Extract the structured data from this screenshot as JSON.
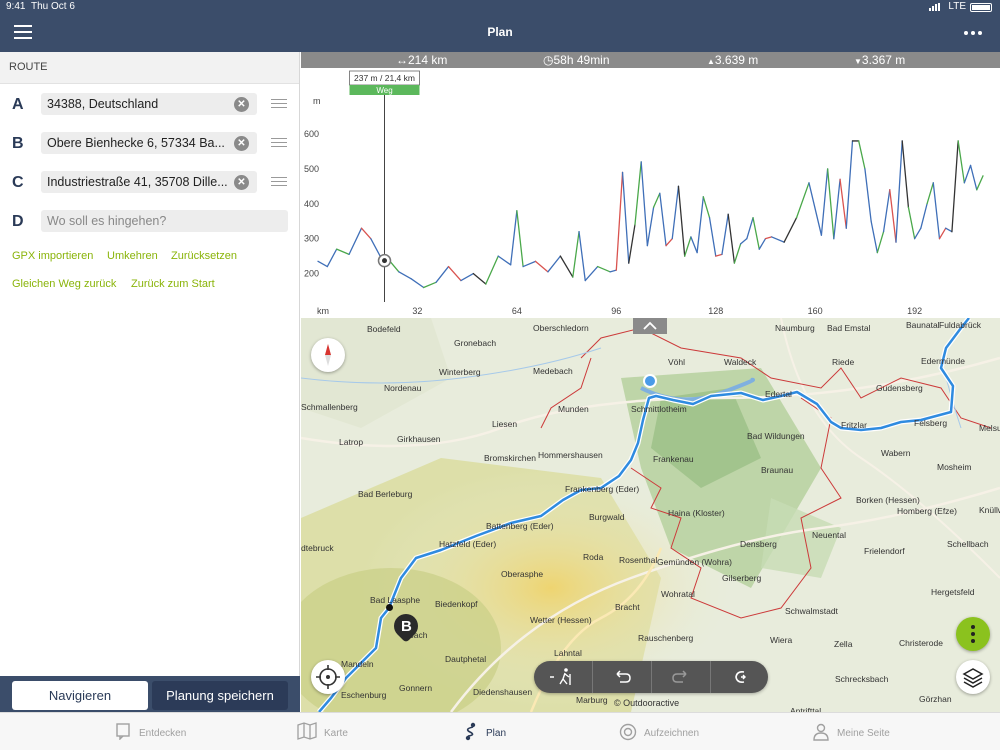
{
  "status_bar": {
    "time": "9:41",
    "date": "Thu Oct 6",
    "network": "LTE"
  },
  "nav": {
    "title": "Plan"
  },
  "route": {
    "header": "ROUTE",
    "waypoints": [
      {
        "letter": "A",
        "value": "34388, Deutschland"
      },
      {
        "letter": "B",
        "value": "Obere Bienhecke 6, 57334 Ba..."
      },
      {
        "letter": "C",
        "value": "Industriestraße 41, 35708 Dille..."
      },
      {
        "letter": "D",
        "value": "",
        "placeholder": "Wo soll es hingehen?"
      }
    ],
    "actions_row1": [
      "GPX importieren",
      "Umkehren",
      "Zurücksetzen"
    ],
    "actions_row2": [
      "Gleichen Weg zurück",
      "Zurück zum Start"
    ],
    "navigate_label": "Navigieren",
    "save_label": "Planung speichern"
  },
  "stats": {
    "distance": "214 km",
    "duration": "58h 49min",
    "ascent": "3.639 m",
    "descent": "3.367 m"
  },
  "profile": {
    "y_unit": "m",
    "x_unit": "km",
    "cursor_label": "237 m / 21,4 km",
    "cursor_surface": "Weg",
    "surface_colors": {
      "trail": "#3f6fb8",
      "road": "#4aa84a",
      "path": "#d9534f",
      "unknown": "#333333"
    }
  },
  "chart_data": {
    "type": "line",
    "title": "",
    "xlabel": "km",
    "ylabel": "m",
    "xlim": [
      0,
      214
    ],
    "ylim": [
      130,
      640
    ],
    "x_ticks": [
      32,
      64,
      96,
      128,
      160,
      192
    ],
    "y_ticks": [
      200,
      300,
      400,
      500,
      600
    ],
    "cursor": {
      "x": 21.4,
      "y": 237
    },
    "series": [
      {
        "x": [
          0,
          3,
          6,
          10,
          14,
          17,
          20,
          23,
          26,
          30,
          34,
          38,
          42,
          46,
          50,
          54,
          58,
          62,
          64,
          66,
          70,
          74,
          78,
          82,
          84,
          86,
          90,
          94,
          96,
          98,
          100,
          102,
          104,
          106,
          108,
          110,
          112,
          114,
          116,
          118,
          120,
          122,
          124,
          126,
          128,
          130,
          132,
          134,
          136,
          138,
          140,
          142,
          144,
          146,
          150,
          154,
          158,
          162,
          164,
          166,
          168,
          170,
          172,
          174,
          176,
          178,
          180,
          182,
          184,
          186,
          188,
          190,
          192,
          194,
          196,
          198,
          200,
          202,
          204,
          206,
          208,
          210,
          212,
          214
        ],
        "y": [
          235,
          220,
          270,
          255,
          330,
          300,
          250,
          237,
          205,
          185,
          160,
          175,
          220,
          180,
          200,
          170,
          250,
          225,
          380,
          220,
          235,
          205,
          250,
          190,
          320,
          180,
          220,
          205,
          210,
          490,
          230,
          340,
          520,
          280,
          390,
          430,
          280,
          300,
          450,
          250,
          305,
          260,
          420,
          360,
          250,
          255,
          370,
          230,
          285,
          300,
          360,
          270,
          300,
          305,
          290,
          360,
          460,
          310,
          500,
          300,
          470,
          330,
          580,
          580,
          500,
          350,
          260,
          320,
          440,
          290,
          580,
          390,
          300,
          330,
          400,
          460,
          300,
          330,
          320,
          580,
          460,
          510,
          440,
          480
        ]
      }
    ]
  },
  "map": {
    "places": [
      "Bodefeld",
      "Gronebach",
      "Oberschledorn",
      "Naumburg",
      "Bad Emstal",
      "Baunatal",
      "Fuldabrück",
      "Vöhl",
      "Waldeck",
      "Riede",
      "Edermünde",
      "Nordenau",
      "Winterberg",
      "Medebach",
      "Schmallenberg",
      "Schmittlotheim",
      "Edertal",
      "Gudensberg",
      "Latrop",
      "Munden",
      "Fritzlar",
      "Felsberg",
      "Girkhausen",
      "Liesen",
      "Bad Wildungen",
      "Melsu",
      "Hommershausen",
      "Bromskirchen",
      "Frankenau",
      "Wabern",
      "Braunau",
      "Mosheim",
      "Bad Berleburg",
      "Frankenberg (Eder)",
      "Borken (Hessen)",
      "Haina (Kloster)",
      "Homberg (Efze)",
      "Knüllw",
      "Burgwald",
      "Battenberg (Eder)",
      "Neuental",
      "Densberg",
      "Schellbach",
      "dtebruck",
      "Hatzfeld (Eder)",
      "Frielendorf",
      "Roda",
      "Rosenthal",
      "Gemünden (Wohra)",
      "Oberasphe",
      "Gilserberg",
      "Hergetsfeld",
      "Bad Laasphe",
      "Biedenkopf",
      "Wohratal",
      "Bracht",
      "Schwalmstadt",
      "Wetter (Hessen)",
      "Rauschenberg",
      "Wiera",
      "Zella",
      "Christerode",
      "Dautphetal",
      "Lahntal",
      "Mandeln",
      "Gonnern",
      "Schrecksbach",
      "Görzhan",
      "Eschenburg",
      "Diedenshausen",
      "Marburg",
      "Antrifttal",
      "bach"
    ],
    "copyright": "© Outdooractive",
    "marker_label": "B"
  },
  "tabbar": {
    "items": [
      "Entdecken",
      "Karte",
      "Plan",
      "Aufzeichnen",
      "Meine Seite"
    ]
  }
}
